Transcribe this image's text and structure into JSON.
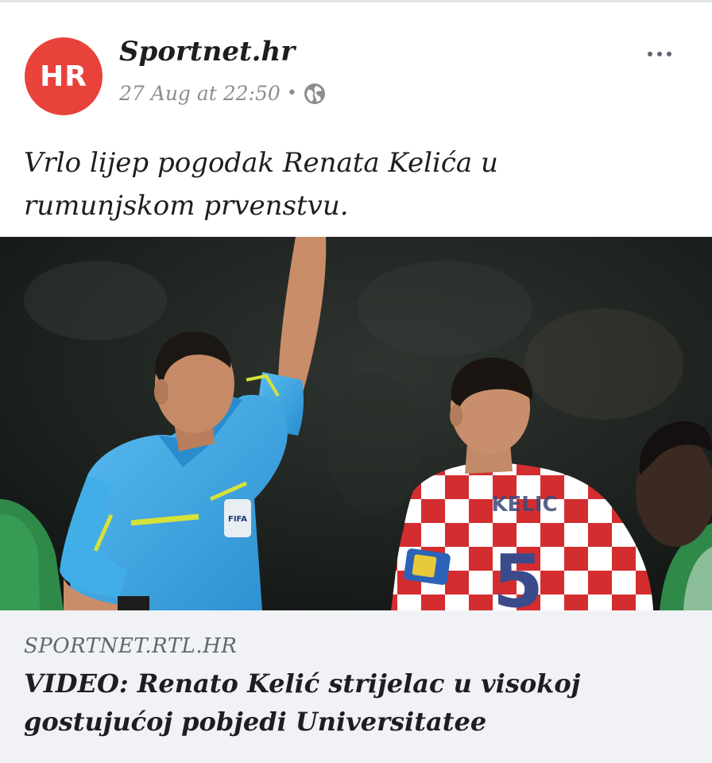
{
  "post": {
    "avatar_text": "HR",
    "page_name": "Sportnet.hr",
    "timestamp": "27 Aug at 22:50",
    "separator": "•",
    "privacy_icon": "globe-icon",
    "more_icon": "more-options-icon",
    "text": "Vrlo lijep pogodak Renata Kelića u rumunjskom prvenstvu."
  },
  "photo": {
    "jersey_name": "KELIC",
    "jersey_number": "5",
    "badge_text": "FIFA"
  },
  "link": {
    "domain": "SPORTNET.RTL.HR",
    "title": "VIDEO: Renato Kelić strijelac u visokoj gostujućoj pobjedi Universitatee"
  },
  "colors": {
    "avatar_bg": "#e8423a",
    "link_bg": "#f0f2f5",
    "referee_shirt": "#3aa3e0",
    "croatia_red": "#d42d2f"
  }
}
